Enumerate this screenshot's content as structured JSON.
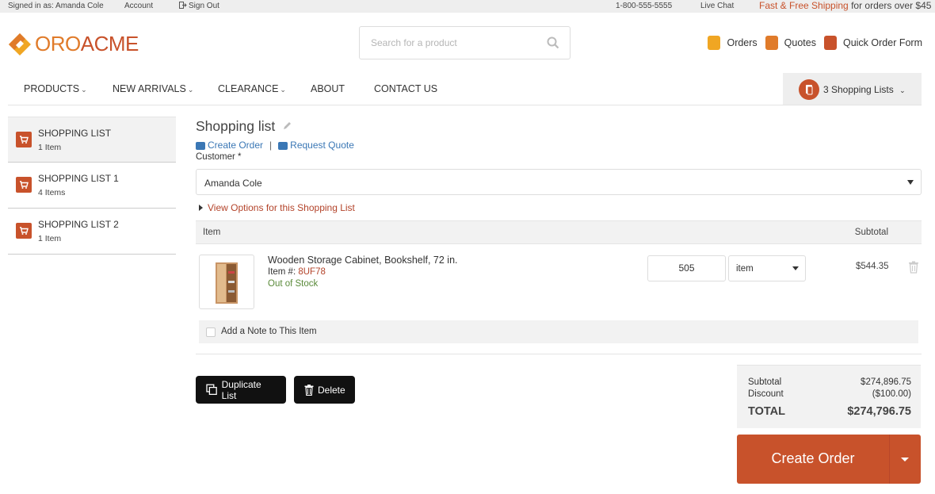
{
  "topbar": {
    "signed_in": "Signed in as: Amanda Cole",
    "account": "Account",
    "sign_out": "Sign Out",
    "phone": "1-800-555-5555",
    "live_chat": "Live Chat",
    "shipping_highlight": "Fast & Free Shipping",
    "shipping_rest": " for orders over $45"
  },
  "logo": {
    "part1": "ORO",
    "part2": "ACME"
  },
  "search": {
    "placeholder": "Search for a product",
    "icon": "search-icon"
  },
  "header_links": [
    {
      "label": "Orders",
      "icon": "orders-icon",
      "color": "#f0a623"
    },
    {
      "label": "Quotes",
      "icon": "quotes-icon",
      "color": "#e07b2a"
    },
    {
      "label": "Quick Order Form",
      "icon": "quick-order-icon",
      "color": "#c8522b"
    }
  ],
  "nav": {
    "items": [
      {
        "label": "PRODUCTS",
        "has_dropdown": true
      },
      {
        "label": "NEW ARRIVALS",
        "has_dropdown": true
      },
      {
        "label": "CLEARANCE",
        "has_dropdown": true
      },
      {
        "label": "ABOUT",
        "has_dropdown": false
      },
      {
        "label": "CONTACT US",
        "has_dropdown": false
      }
    ],
    "shopping_lists_label": "3 Shopping Lists"
  },
  "sidebar": {
    "items": [
      {
        "title": "SHOPPING LIST",
        "count": "1 Item",
        "active": true
      },
      {
        "title": "SHOPPING LIST 1",
        "count": "4 Items",
        "active": false
      },
      {
        "title": "SHOPPING LIST 2",
        "count": "1 Item",
        "active": false
      }
    ]
  },
  "main": {
    "title": "Shopping list",
    "create_order_link": "Create Order",
    "request_quote_link": "Request Quote",
    "customer_label": "Customer *",
    "customer_value": "Amanda Cole",
    "view_options": "View Options for this Shopping List",
    "table_headers": {
      "item": "Item",
      "subtotal": "Subtotal"
    },
    "line_item": {
      "name": "Wooden Storage Cabinet, Bookshelf, 72 in.",
      "sku_label": "Item #:",
      "sku": "8UF78",
      "stock": "Out of Stock",
      "quantity": "505",
      "unit": "item",
      "subtotal": "$544.35"
    },
    "note_label": "Add a Note to This Item",
    "duplicate_button": "Duplicate List",
    "delete_button": "Delete"
  },
  "totals": {
    "subtotal_label": "Subtotal",
    "subtotal_value": "$274,896.75",
    "discount_label": "Discount",
    "discount_value": "($100.00)",
    "total_label": "TOTAL",
    "total_value": "$274,796.75"
  },
  "create_order_button": "Create Order",
  "colors": {
    "accent": "#c8522b",
    "link": "#3a77b5",
    "stock": "#5a8a3a"
  }
}
